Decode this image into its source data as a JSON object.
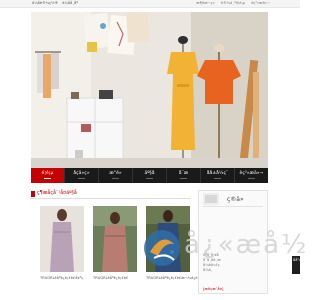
{
  "topbar": {
    "left": [
      "ä¼åè®¾ç½®",
      "ä¼åå¸åº"
    ],
    "right": [
      "æ¶èæ¬ç«",
      "è®¾ä¸ºé¦é¡µ",
      "èç³»æä»¬"
    ]
  },
  "nav": {
    "items": [
      {
        "label": "é¦é¡µ",
        "active": true
      },
      {
        "label": "åçä»ç»",
        "active": false
      },
      {
        "label": "æ°é»",
        "active": false
      },
      {
        "label": "äº§å",
        "active": false
      },
      {
        "label": "å¨æ",
        "active": false
      },
      {
        "label": "åå±å½ç¨",
        "active": false
      },
      {
        "label": "èç³»æä»¬",
        "active": false
      }
    ],
    "active_color": "#c40000",
    "background_color": "#1a1a1a"
  },
  "products_section": {
    "title": "ç¶æåçå¯¹å¤äº§å",
    "items": [
      {
        "caption": "TRUGRLéåºè¿è¡£è£å¥³ç"
      },
      {
        "caption": "TRUGRLéåºè¿è¡£è£"
      },
      {
        "caption": "TRUGRLéåºè¿è¡£è£æ¬¾è¿è¡£è£"
      }
    ]
  },
  "about_box": {
    "title": "ç®ä»",
    "lines": [
      "èªå¨å·¥å",
      "å¯ä¸åä¸æ",
      "å¼éä»£ç",
      "å¾ä¸"
    ],
    "link": "[æ¥çæ´å¤]"
  },
  "watermark": {
    "text": "å¿«æå½"
  },
  "side_button": {
    "label": "åå°ç®¡ç"
  }
}
